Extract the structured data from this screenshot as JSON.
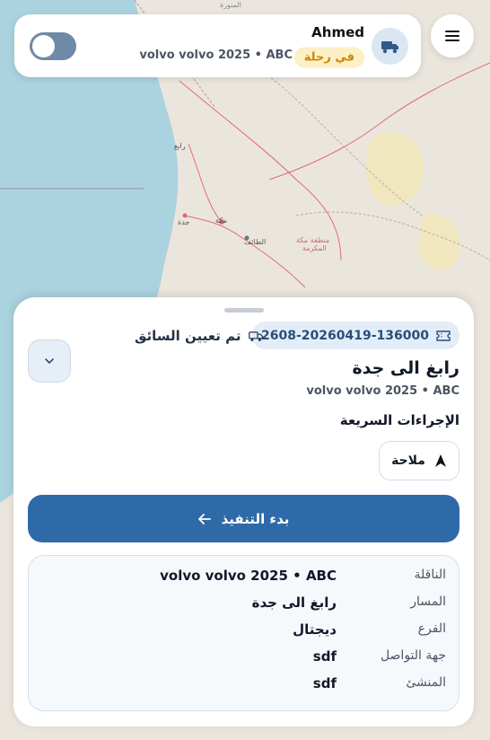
{
  "map": {
    "labels": [
      "المنورة",
      "رابغ",
      "مكة",
      "جدة",
      "الطائف",
      "منطقة مكة",
      "المكرمة"
    ]
  },
  "topbar": {
    "driver_name": "Ahmed",
    "status": "في رحلة",
    "vehicle": "volvo volvo 2025 • ABC",
    "truck_icon": "truck-icon",
    "toggle_on": false
  },
  "menu": {
    "icon": "hamburger-icon"
  },
  "sheet": {
    "trip_id": "2608-20260419-136000",
    "trip_id_icon": "ticket-icon",
    "assign_status": "تم تعيين السائق",
    "assign_icon": "truck-icon",
    "route_title": "رابغ الى جدة",
    "route_vehicle": "volvo volvo 2025 • ABC",
    "quick_actions_title": "الإجراءات السريعة",
    "navigate_label": "ملاحة",
    "start_label": "بدء التنفيذ",
    "details": [
      {
        "label": "الناقلة",
        "value": "volvo volvo 2025 • ABC"
      },
      {
        "label": "المسار",
        "value": "رابغ الى جدة"
      },
      {
        "label": "الفرع",
        "value": "ديجتال"
      },
      {
        "label": "جهة التواصل",
        "value": "sdf"
      },
      {
        "label": "المنشئ",
        "value": "sdf"
      }
    ]
  },
  "colors": {
    "primary": "#2f6aa8",
    "status_bg": "#fdefc6",
    "status_text": "#c98a00",
    "sea": "#aad3df",
    "land": "#ece7df"
  }
}
